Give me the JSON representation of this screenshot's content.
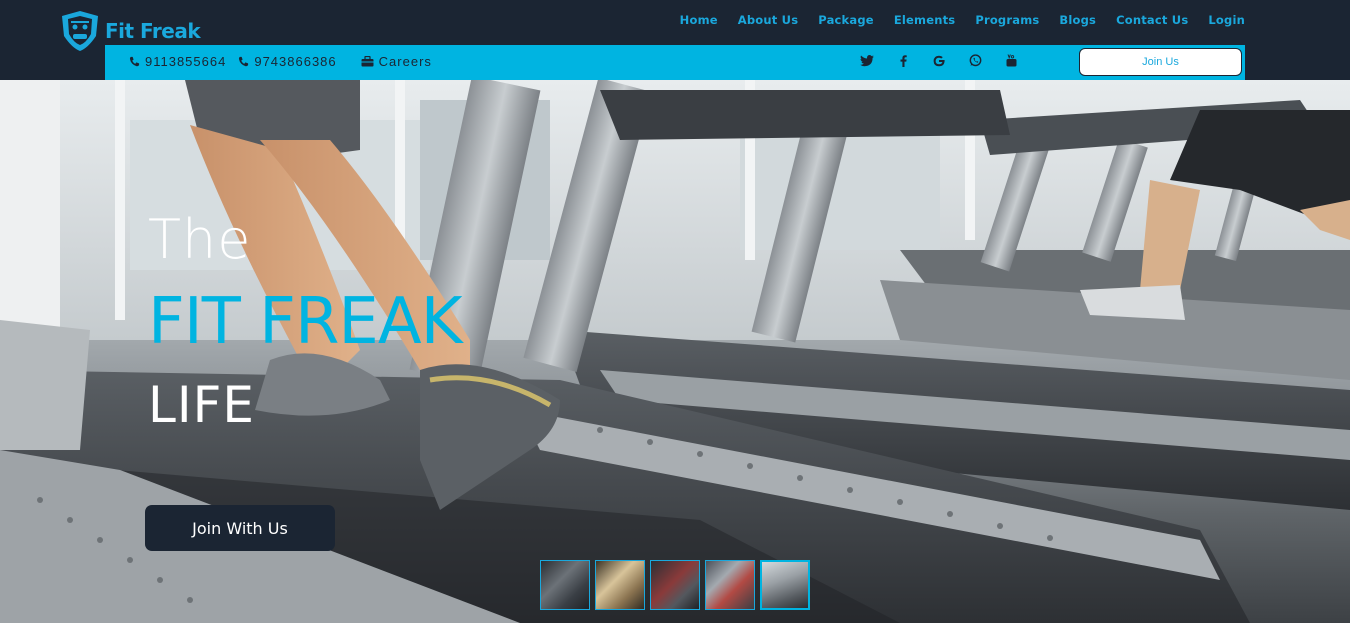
{
  "brand": {
    "name": "Fit Freak"
  },
  "nav": {
    "items": [
      "Home",
      "About Us",
      "Package",
      "Elements",
      "Programs",
      "Blogs",
      "Contact Us",
      "Login"
    ]
  },
  "topbar": {
    "phone1": "9113855664",
    "phone2": "9743866386",
    "careers": "Careers",
    "join_label": "Join Us",
    "social_icons": [
      "twitter-icon",
      "facebook-icon",
      "google-icon",
      "whatsapp-icon",
      "youtube-icon"
    ]
  },
  "hero": {
    "line1": "The",
    "line2": "FIT FREAK",
    "line3": "LIFE",
    "cta_label": "Join With Us",
    "thumbnails": [
      {
        "name": "gym-interior-thumb",
        "active": false
      },
      {
        "name": "gym-equipment-thumb",
        "active": false
      },
      {
        "name": "gym-red-room-thumb",
        "active": false
      },
      {
        "name": "weights-thumb",
        "active": false
      },
      {
        "name": "treadmill-thumb",
        "active": true
      }
    ]
  },
  "colors": {
    "navy": "#1b2533",
    "accent": "#00b4e1",
    "link": "#1aa8dd",
    "white": "#ffffff"
  }
}
